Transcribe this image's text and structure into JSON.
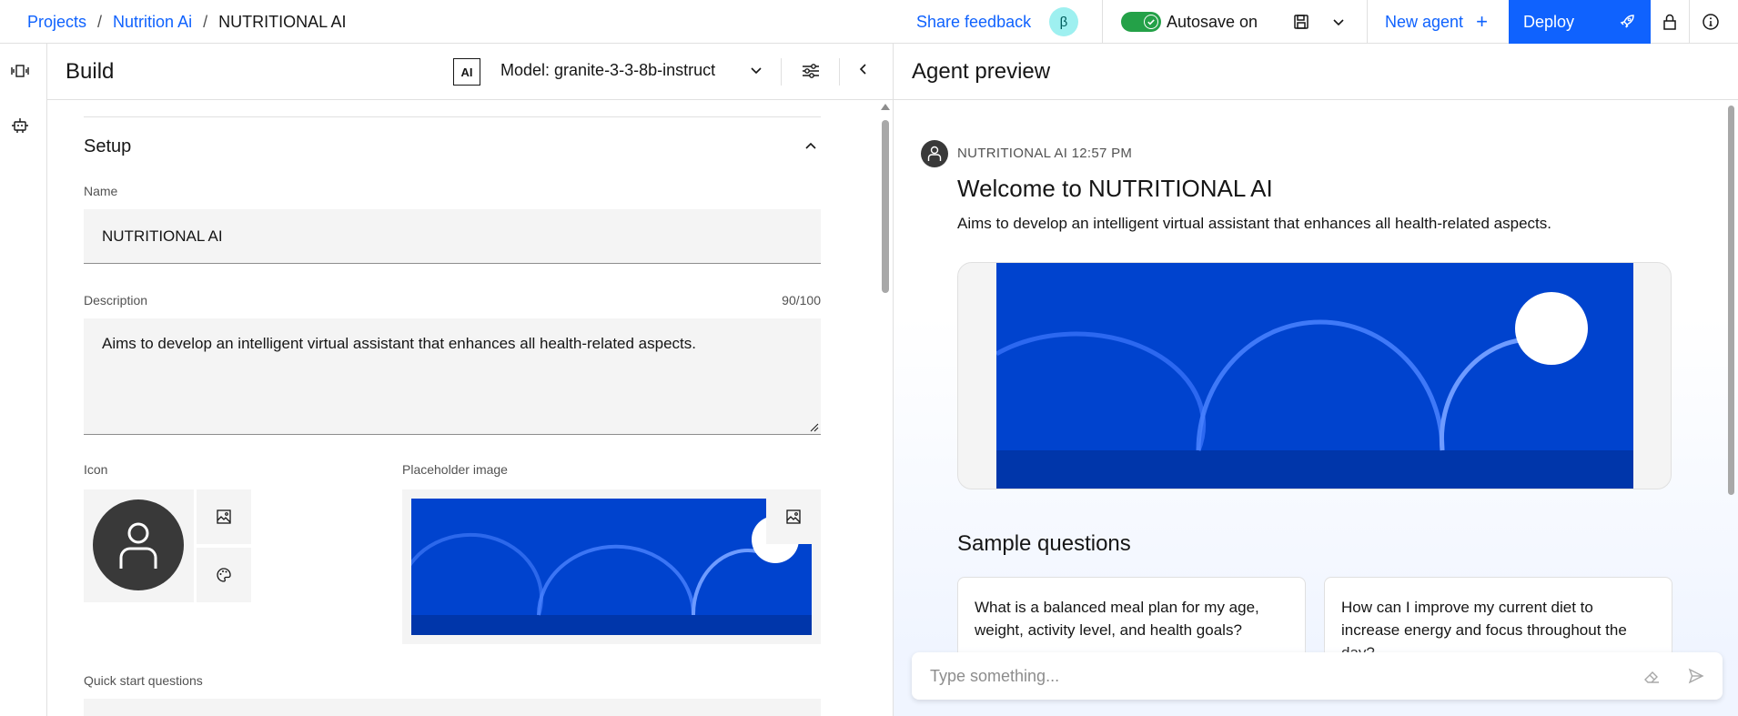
{
  "breadcrumb": {
    "projects": "Projects",
    "sep1": "/",
    "project": "Nutrition Ai",
    "sep2": "/",
    "agent": "NUTRITIONAL AI"
  },
  "header": {
    "share_feedback": "Share feedback",
    "beta": "β",
    "autosave_label": "Autosave on",
    "autosave_enabled": true,
    "new_agent": "New agent",
    "new_agent_plus": "+",
    "deploy": "Deploy"
  },
  "build": {
    "title": "Build",
    "ai_badge": "AI",
    "model_label": "Model: granite-3-3-8b-instruct",
    "setup_title": "Setup",
    "name_label": "Name",
    "name_value": "NUTRITIONAL AI",
    "description_label": "Description",
    "description_count": "90/100",
    "description_value": "Aims to develop an intelligent virtual assistant that enhances all health-related aspects.",
    "icon_label": "Icon",
    "placeholder_label": "Placeholder image",
    "quick_start_label": "Quick start questions"
  },
  "preview": {
    "title": "Agent preview",
    "message_meta": "NUTRITIONAL AI 12:57 PM",
    "welcome": "Welcome to NUTRITIONAL AI",
    "description": "Aims to develop an intelligent virtual assistant that enhances all health-related aspects.",
    "sample_title": "Sample questions",
    "samples": [
      "What is a balanced meal plan for my age, weight, activity level, and health goals?",
      "How can I improve my current diet to increase energy and focus throughout the day?"
    ],
    "input_placeholder": "Type something..."
  },
  "colors": {
    "accent": "#0f62fe",
    "toggle_on": "#24a148",
    "banner_blue": "#0043ce",
    "avatar_dark": "#393939"
  },
  "icons": {
    "rail": [
      "agent-flow-icon",
      "bot-icon"
    ],
    "toolbar": [
      "save-icon",
      "chevron-down-icon",
      "lock-icon",
      "info-icon",
      "rocket-icon"
    ]
  }
}
